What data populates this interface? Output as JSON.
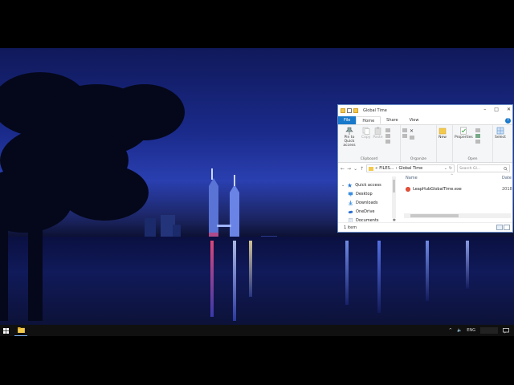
{
  "window": {
    "title": "Global Time",
    "controls": {
      "minimize": "–",
      "maximize": "□",
      "close": "✕"
    }
  },
  "ribbon": {
    "tabs": [
      {
        "label": "File",
        "kind": "file"
      },
      {
        "label": "Home",
        "kind": "active"
      },
      {
        "label": "Share",
        "kind": "normal"
      },
      {
        "label": "View",
        "kind": "normal"
      }
    ],
    "help": "?",
    "groups": {
      "clipboard": {
        "label": "Clipboard",
        "pin_label": "Pin to Quick access",
        "copy_label": "Copy",
        "paste_label": "Paste"
      },
      "organize": {
        "label": "Organize"
      },
      "new": {
        "label": "New"
      },
      "open": {
        "label": "Open",
        "properties_label": "Properties"
      },
      "select": {
        "label": "Select"
      }
    }
  },
  "address": {
    "path_prefix": "«",
    "path_parent": "FILES...",
    "separator": "›",
    "path_current": "Global Time",
    "dropdown": "⌄",
    "refresh": "↻",
    "search_placeholder": "Search Gl..."
  },
  "nav_pane": {
    "items": [
      {
        "label": "Quick access",
        "icon": "star-icon",
        "color": "#2b7bd6",
        "pin": ""
      },
      {
        "label": "Desktop",
        "icon": "desktop-icon",
        "color": "#3b8fe0",
        "pin": "✱"
      },
      {
        "label": "Downloads",
        "icon": "download-icon",
        "color": "#3b8fe0",
        "pin": "✱"
      },
      {
        "label": "OneDrive",
        "icon": "cloud-icon",
        "color": "#2a6fd0",
        "pin": ""
      },
      {
        "label": "Documents",
        "icon": "documents-icon",
        "color": "#8aa0bd",
        "pin": "✱"
      }
    ]
  },
  "files": {
    "columns": {
      "name": "Name",
      "date": "Date"
    },
    "sort_indicator": "^",
    "rows": [
      {
        "name": "LeapHubGlobalTime.exe",
        "date": "2018"
      }
    ]
  },
  "status": {
    "item_count": "1 item"
  },
  "taskbar": {
    "language": "ENG",
    "tray_up": "^",
    "volume": "🔈"
  }
}
